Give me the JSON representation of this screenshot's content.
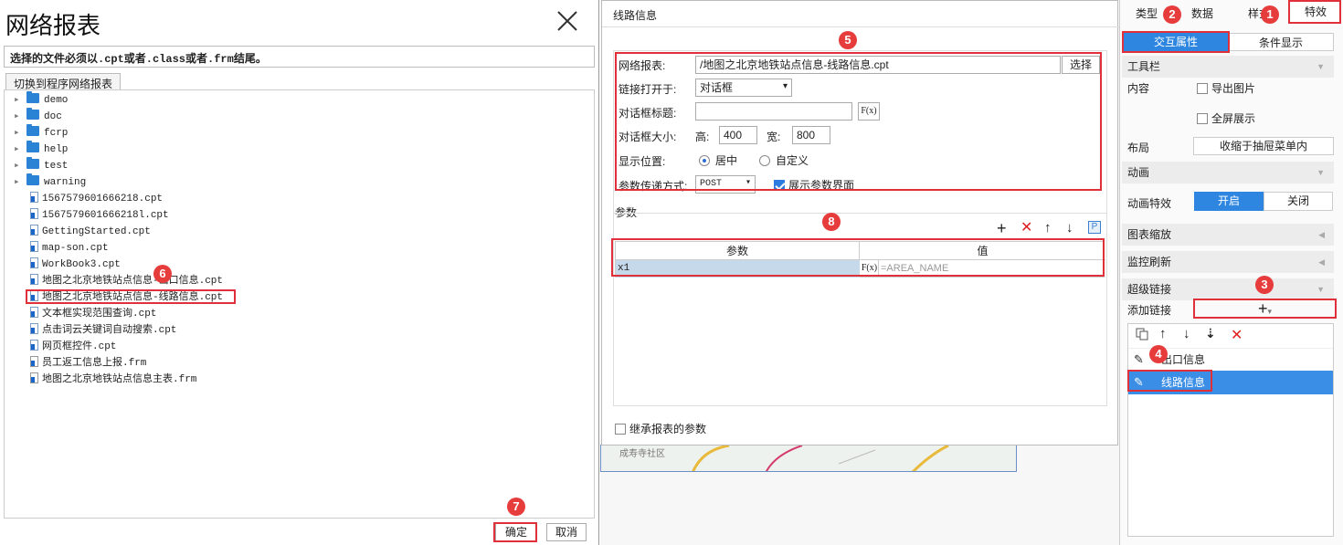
{
  "dialog": {
    "title": "网络报表",
    "note": "选择的文件必须以.cpt或者.class或者.frm结尾。",
    "switch_label": "切换到程序网络报表",
    "ok": "确定",
    "cancel": "取消",
    "tree": [
      {
        "label": "demo",
        "type": "folder"
      },
      {
        "label": "doc",
        "type": "folder"
      },
      {
        "label": "fcrp",
        "type": "folder"
      },
      {
        "label": "help",
        "type": "folder"
      },
      {
        "label": "test",
        "type": "folder"
      },
      {
        "label": "warning",
        "type": "folder"
      },
      {
        "label": "1567579601666218.cpt",
        "type": "file"
      },
      {
        "label": "1567579601666218l.cpt",
        "type": "file"
      },
      {
        "label": "GettingStarted.cpt",
        "type": "file"
      },
      {
        "label": "map-son.cpt",
        "type": "file"
      },
      {
        "label": "WorkBook3.cpt",
        "type": "file"
      },
      {
        "label": "地图之北京地铁站点信息-出口信息.cpt",
        "type": "file"
      },
      {
        "label": "地图之北京地铁站点信息-线路信息.cpt",
        "type": "file"
      },
      {
        "label": "文本框实现范围查询.cpt",
        "type": "file"
      },
      {
        "label": "点击词云关键词自动搜索.cpt",
        "type": "file"
      },
      {
        "label": "网页框控件.cpt",
        "type": "file"
      },
      {
        "label": "员工返工信息上报.frm",
        "type": "frm"
      },
      {
        "label": "地图之北京地铁站点信息主表.frm",
        "type": "frm"
      }
    ]
  },
  "link": {
    "title": "线路信息",
    "report_label": "网络报表:",
    "report_value": "/地图之北京地铁站点信息-线路信息.cpt",
    "choose": "选择",
    "open_label": "链接打开于:",
    "open_value": "对话框",
    "dlg_title_label": "对话框标题:",
    "fx": "F(x)",
    "size_label": "对话框大小:",
    "h_label": "高:",
    "h_value": "400",
    "w_label": "宽:",
    "w_value": "800",
    "pos_label": "显示位置:",
    "pos_center": "居中",
    "pos_custom": "自定义",
    "param_mode_label": "参数传递方式:",
    "param_mode": "POST",
    "show_params": "展示参数界面",
    "params_title": "参数",
    "col_param": "参数",
    "col_value": "值",
    "row_param": "x1",
    "row_value": "=AREA_NAME",
    "inherit": "继承报表的参数",
    "map_text": "成寿寺社区"
  },
  "right": {
    "tabs": [
      "类型",
      "数据",
      "样式",
      "特效"
    ],
    "sub_tabs": [
      "交互属性",
      "条件显示"
    ],
    "toolbar": "工具栏",
    "content": "内容",
    "export_img": "导出图片",
    "fullscreen": "全屏展示",
    "layout": "布局",
    "layout_value": "收缩于抽屉菜单内",
    "animation": "动画",
    "anim_effect": "动画特效",
    "on": "开启",
    "off": "关闭",
    "zoom": "图表缩放",
    "monitor": "监控刷新",
    "hyperlink": "超级链接",
    "add_link": "添加链接",
    "links": [
      "出口信息",
      "线路信息"
    ]
  },
  "badges": [
    "1",
    "2",
    "3",
    "4",
    "5",
    "6",
    "7",
    "8"
  ]
}
